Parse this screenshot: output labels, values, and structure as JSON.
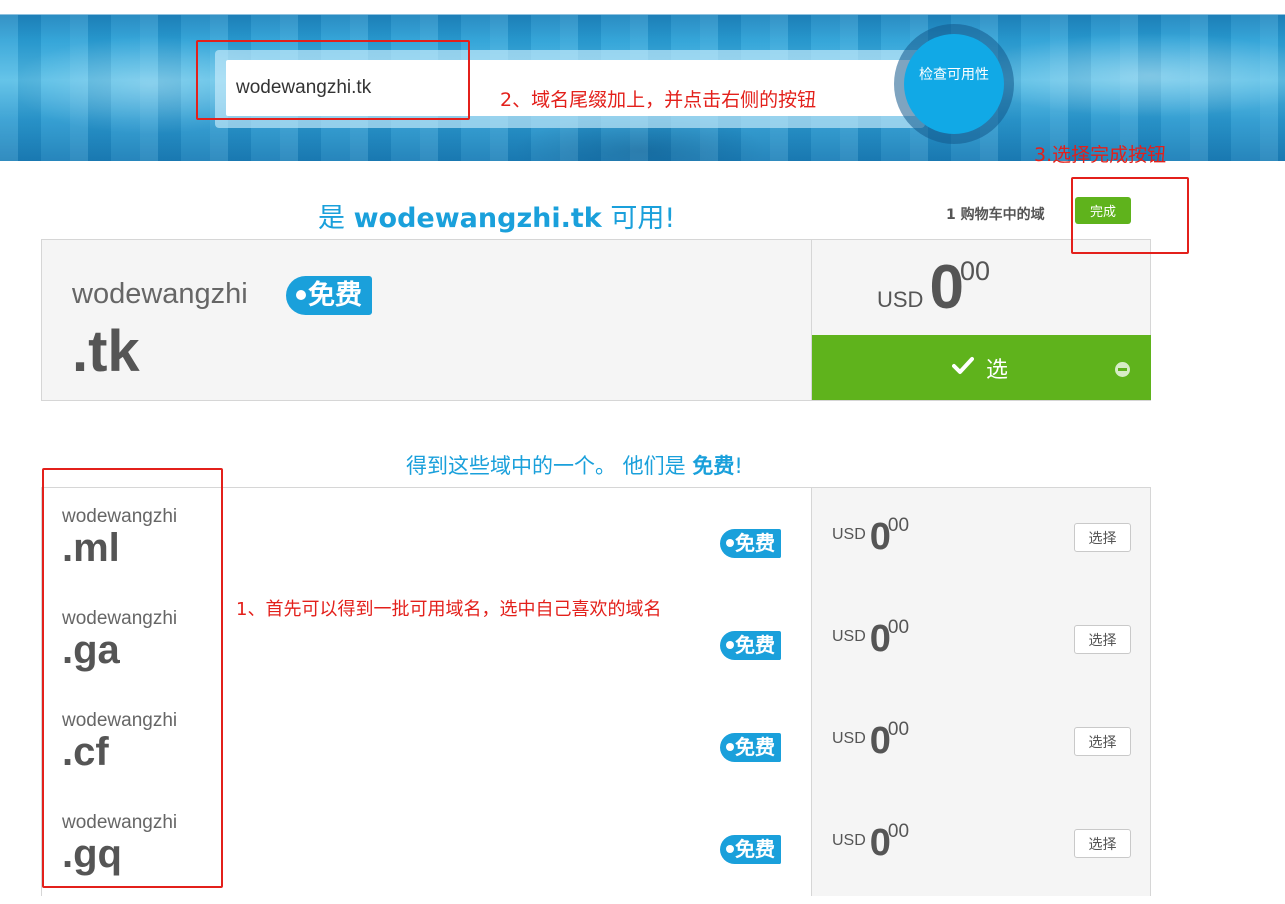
{
  "search": {
    "value": "wodewangzhi.tk",
    "check_button_label": "检查可用性"
  },
  "annotations": {
    "step1": "1、首先可以得到一批可用域名，选中自己喜欢的域名",
    "step2": "2、域名尾缀加上，并点击右侧的按钮",
    "step3": "3.选择完成按钮"
  },
  "result": {
    "title_prefix": "是",
    "title_domain": "wodewangzhi.tk",
    "title_suffix": "可用!",
    "cart_count_text": "1 购物车中的域",
    "done_button_label": "完成",
    "domain_name": "wodewangzhi",
    "tld": ".tk",
    "free_badge": "免费",
    "currency": "USD",
    "price_whole": "0",
    "price_cents": "00",
    "select_button_label": "选"
  },
  "suggestions": {
    "title_text": "得到这些域中的一个。 他们是",
    "title_em": "免费",
    "title_end": "!",
    "items": [
      {
        "name": "wodewangzhi",
        "tld": ".ml",
        "badge": "免费",
        "currency": "USD",
        "price_whole": "0",
        "price_cents": "00",
        "button": "选择"
      },
      {
        "name": "wodewangzhi",
        "tld": ".ga",
        "badge": "免费",
        "currency": "USD",
        "price_whole": "0",
        "price_cents": "00",
        "button": "选择"
      },
      {
        "name": "wodewangzhi",
        "tld": ".cf",
        "badge": "免费",
        "currency": "USD",
        "price_whole": "0",
        "price_cents": "00",
        "button": "选择"
      },
      {
        "name": "wodewangzhi",
        "tld": ".gq",
        "badge": "免费",
        "currency": "USD",
        "price_whole": "0",
        "price_cents": "00",
        "button": "选择"
      }
    ]
  },
  "colors": {
    "accent_blue": "#1aa0db",
    "accent_green": "#5fb31c",
    "annotation_red": "#e3201b"
  }
}
